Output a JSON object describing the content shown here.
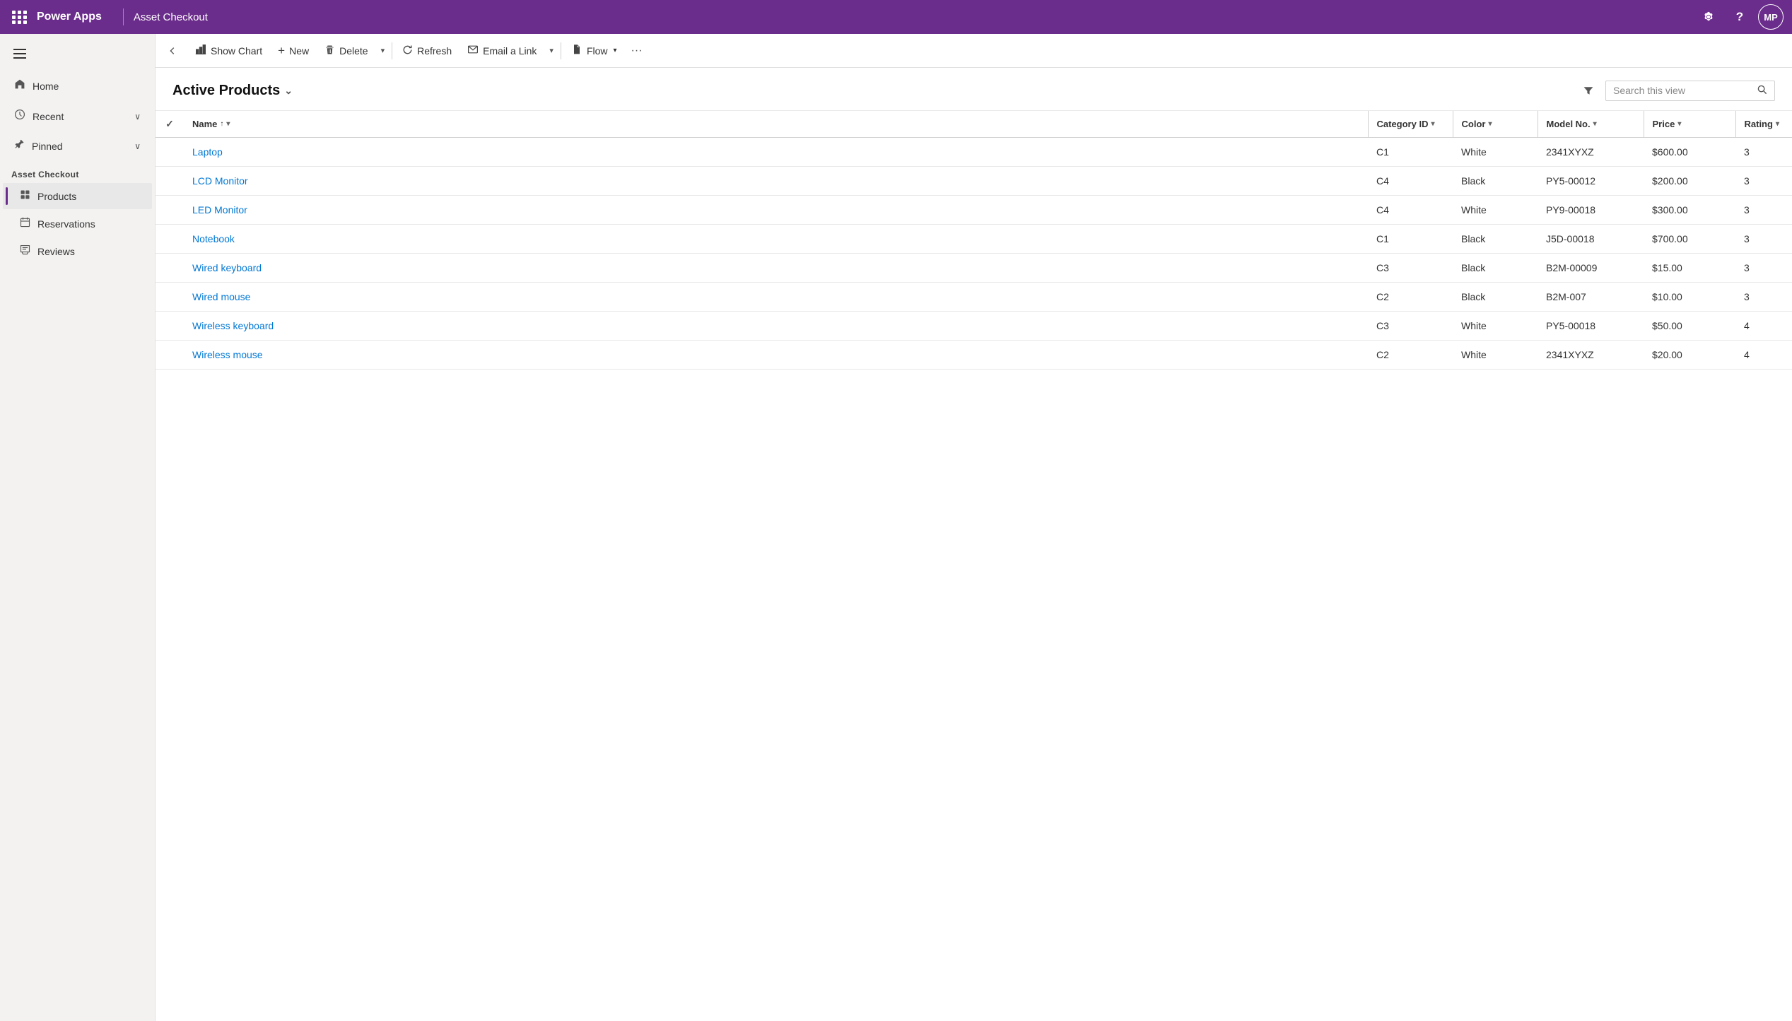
{
  "topbar": {
    "logo": "Power Apps",
    "app_title": "Asset Checkout",
    "settings_icon": "⚙",
    "help_icon": "?",
    "avatar_initials": "MP"
  },
  "toolbar": {
    "back_icon": "←",
    "show_chart_label": "Show Chart",
    "new_label": "New",
    "delete_label": "Delete",
    "refresh_label": "Refresh",
    "email_link_label": "Email a Link",
    "flow_label": "Flow",
    "more_icon": "•••"
  },
  "view": {
    "title": "Active Products",
    "title_chevron": "⌄",
    "filter_icon": "▽",
    "search_placeholder": "Search this view"
  },
  "table": {
    "columns": [
      {
        "id": "name",
        "label": "Name",
        "sortable": true,
        "sort_dir": "asc"
      },
      {
        "id": "category_id",
        "label": "Category ID",
        "sortable": true
      },
      {
        "id": "color",
        "label": "Color",
        "sortable": true
      },
      {
        "id": "model_no",
        "label": "Model No.",
        "sortable": true
      },
      {
        "id": "price",
        "label": "Price",
        "sortable": true
      },
      {
        "id": "rating",
        "label": "Rating",
        "sortable": true
      }
    ],
    "rows": [
      {
        "name": "Laptop",
        "category_id": "C1",
        "color": "White",
        "model_no": "2341XYXZ",
        "price": "$600.00",
        "rating": "3"
      },
      {
        "name": "LCD Monitor",
        "category_id": "C4",
        "color": "Black",
        "model_no": "PY5-00012",
        "price": "$200.00",
        "rating": "3"
      },
      {
        "name": "LED Monitor",
        "category_id": "C4",
        "color": "White",
        "model_no": "PY9-00018",
        "price": "$300.00",
        "rating": "3"
      },
      {
        "name": "Notebook",
        "category_id": "C1",
        "color": "Black",
        "model_no": "J5D-00018",
        "price": "$700.00",
        "rating": "3"
      },
      {
        "name": "Wired keyboard",
        "category_id": "C3",
        "color": "Black",
        "model_no": "B2M-00009",
        "price": "$15.00",
        "rating": "3"
      },
      {
        "name": "Wired mouse",
        "category_id": "C2",
        "color": "Black",
        "model_no": "B2M-007",
        "price": "$10.00",
        "rating": "3"
      },
      {
        "name": "Wireless keyboard",
        "category_id": "C3",
        "color": "White",
        "model_no": "PY5-00018",
        "price": "$50.00",
        "rating": "4"
      },
      {
        "name": "Wireless mouse",
        "category_id": "C2",
        "color": "White",
        "model_no": "2341XYXZ",
        "price": "$20.00",
        "rating": "4"
      }
    ]
  },
  "sidebar": {
    "nav_items": [
      {
        "id": "home",
        "label": "Home",
        "icon": "⌂",
        "has_chevron": false
      },
      {
        "id": "recent",
        "label": "Recent",
        "icon": "🕐",
        "has_chevron": true
      },
      {
        "id": "pinned",
        "label": "Pinned",
        "icon": "📌",
        "has_chevron": true
      }
    ],
    "section_title": "Asset Checkout",
    "sub_items": [
      {
        "id": "products",
        "label": "Products",
        "icon": "🗂",
        "active": true
      },
      {
        "id": "reservations",
        "label": "Reservations",
        "icon": "📋",
        "active": false
      },
      {
        "id": "reviews",
        "label": "Reviews",
        "icon": "📝",
        "active": false
      }
    ]
  },
  "colors": {
    "topbar_bg": "#6b2d8b",
    "active_indicator": "#6b2d8b",
    "link": "#0078d4"
  }
}
